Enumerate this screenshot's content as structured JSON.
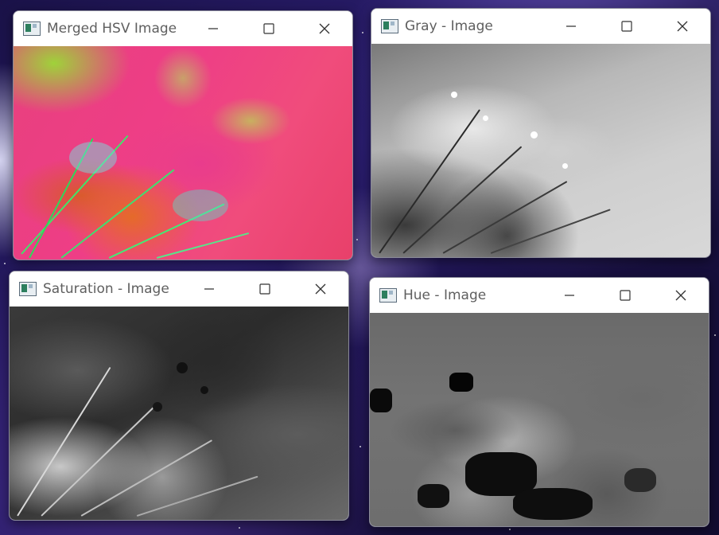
{
  "windows": {
    "merged": {
      "title": "Merged HSV Image"
    },
    "gray": {
      "title": "Gray - Image"
    },
    "saturation": {
      "title": "Saturation - Image"
    },
    "hue": {
      "title": "Hue - Image"
    }
  },
  "icons": {
    "app": "opencv-window-icon",
    "minimize": "minimize-icon",
    "maximize": "maximize-icon",
    "close": "close-icon"
  },
  "colors": {
    "titlebar": "#ffffff",
    "title_text": "#5f5f5f",
    "desktop_bg": "#1a1248"
  }
}
